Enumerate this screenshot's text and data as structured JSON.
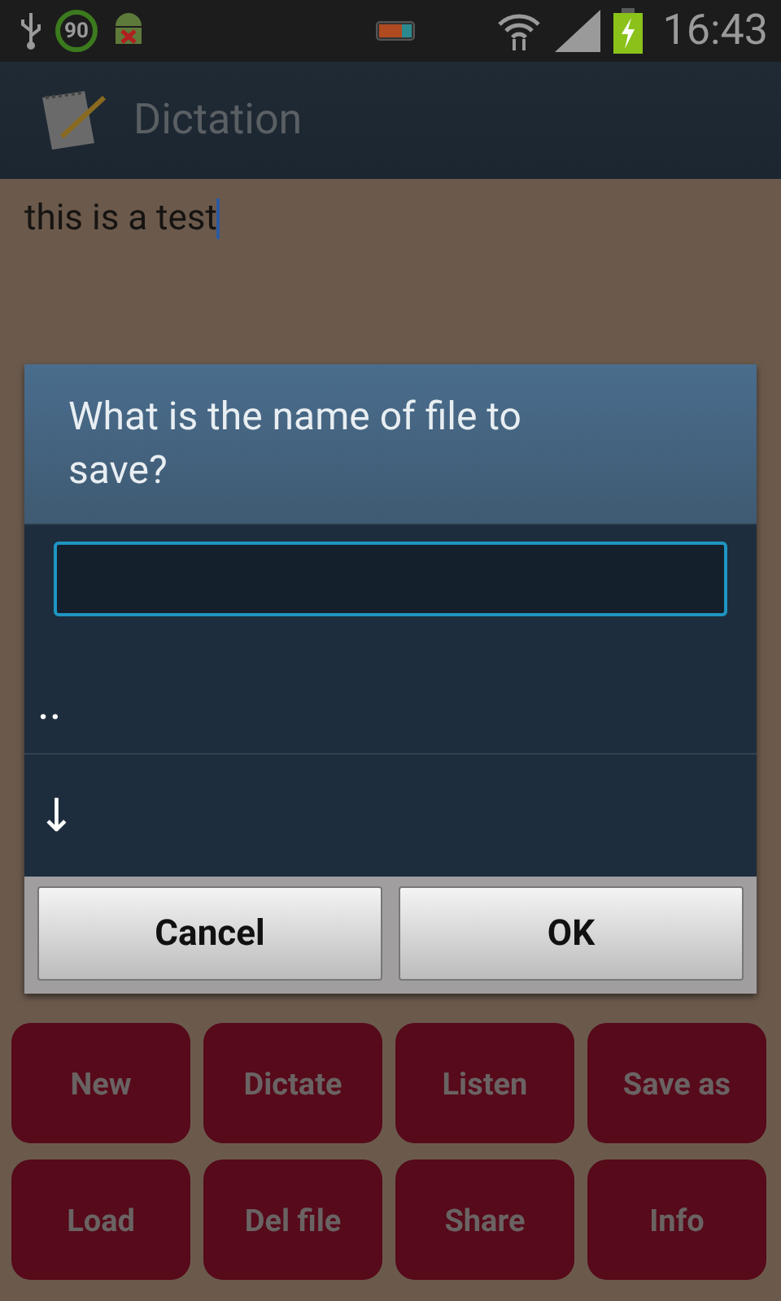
{
  "status_bar": {
    "badge": "90",
    "time": "16:43"
  },
  "app_bar": {
    "title": "Dictation"
  },
  "editor": {
    "value": "this is a test"
  },
  "dialog": {
    "title": "What is the name of file to save?",
    "items": [
      {
        "label": ".."
      },
      {
        "label": "↓"
      }
    ],
    "buttons": [
      "Cancel",
      "OK"
    ]
  },
  "buttons": [
    {
      "label": "New"
    },
    {
      "label": "Dictate"
    },
    {
      "label": "Listen"
    },
    {
      "label": "Save as"
    },
    {
      "label": "Load"
    },
    {
      "label": "Del file"
    },
    {
      "label": "Share"
    },
    {
      "label": "Info"
    }
  ]
}
